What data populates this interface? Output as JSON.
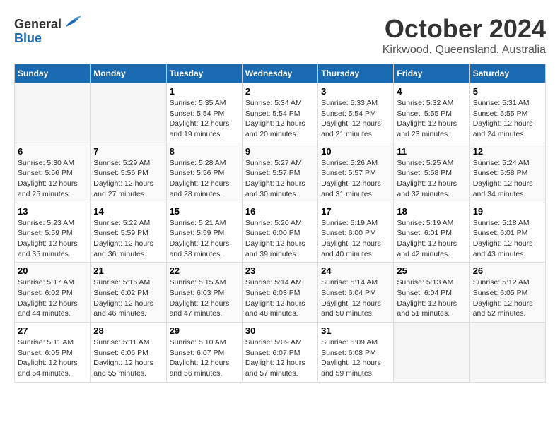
{
  "header": {
    "logo_general": "General",
    "logo_blue": "Blue",
    "month_title": "October 2024",
    "location": "Kirkwood, Queensland, Australia"
  },
  "days_of_week": [
    "Sunday",
    "Monday",
    "Tuesday",
    "Wednesday",
    "Thursday",
    "Friday",
    "Saturday"
  ],
  "weeks": [
    [
      {
        "day": "",
        "sunrise": "",
        "sunset": "",
        "daylight": ""
      },
      {
        "day": "",
        "sunrise": "",
        "sunset": "",
        "daylight": ""
      },
      {
        "day": "1",
        "sunrise": "Sunrise: 5:35 AM",
        "sunset": "Sunset: 5:54 PM",
        "daylight": "Daylight: 12 hours and 19 minutes."
      },
      {
        "day": "2",
        "sunrise": "Sunrise: 5:34 AM",
        "sunset": "Sunset: 5:54 PM",
        "daylight": "Daylight: 12 hours and 20 minutes."
      },
      {
        "day": "3",
        "sunrise": "Sunrise: 5:33 AM",
        "sunset": "Sunset: 5:54 PM",
        "daylight": "Daylight: 12 hours and 21 minutes."
      },
      {
        "day": "4",
        "sunrise": "Sunrise: 5:32 AM",
        "sunset": "Sunset: 5:55 PM",
        "daylight": "Daylight: 12 hours and 23 minutes."
      },
      {
        "day": "5",
        "sunrise": "Sunrise: 5:31 AM",
        "sunset": "Sunset: 5:55 PM",
        "daylight": "Daylight: 12 hours and 24 minutes."
      }
    ],
    [
      {
        "day": "6",
        "sunrise": "Sunrise: 5:30 AM",
        "sunset": "Sunset: 5:56 PM",
        "daylight": "Daylight: 12 hours and 25 minutes."
      },
      {
        "day": "7",
        "sunrise": "Sunrise: 5:29 AM",
        "sunset": "Sunset: 5:56 PM",
        "daylight": "Daylight: 12 hours and 27 minutes."
      },
      {
        "day": "8",
        "sunrise": "Sunrise: 5:28 AM",
        "sunset": "Sunset: 5:56 PM",
        "daylight": "Daylight: 12 hours and 28 minutes."
      },
      {
        "day": "9",
        "sunrise": "Sunrise: 5:27 AM",
        "sunset": "Sunset: 5:57 PM",
        "daylight": "Daylight: 12 hours and 30 minutes."
      },
      {
        "day": "10",
        "sunrise": "Sunrise: 5:26 AM",
        "sunset": "Sunset: 5:57 PM",
        "daylight": "Daylight: 12 hours and 31 minutes."
      },
      {
        "day": "11",
        "sunrise": "Sunrise: 5:25 AM",
        "sunset": "Sunset: 5:58 PM",
        "daylight": "Daylight: 12 hours and 32 minutes."
      },
      {
        "day": "12",
        "sunrise": "Sunrise: 5:24 AM",
        "sunset": "Sunset: 5:58 PM",
        "daylight": "Daylight: 12 hours and 34 minutes."
      }
    ],
    [
      {
        "day": "13",
        "sunrise": "Sunrise: 5:23 AM",
        "sunset": "Sunset: 5:59 PM",
        "daylight": "Daylight: 12 hours and 35 minutes."
      },
      {
        "day": "14",
        "sunrise": "Sunrise: 5:22 AM",
        "sunset": "Sunset: 5:59 PM",
        "daylight": "Daylight: 12 hours and 36 minutes."
      },
      {
        "day": "15",
        "sunrise": "Sunrise: 5:21 AM",
        "sunset": "Sunset: 5:59 PM",
        "daylight": "Daylight: 12 hours and 38 minutes."
      },
      {
        "day": "16",
        "sunrise": "Sunrise: 5:20 AM",
        "sunset": "Sunset: 6:00 PM",
        "daylight": "Daylight: 12 hours and 39 minutes."
      },
      {
        "day": "17",
        "sunrise": "Sunrise: 5:19 AM",
        "sunset": "Sunset: 6:00 PM",
        "daylight": "Daylight: 12 hours and 40 minutes."
      },
      {
        "day": "18",
        "sunrise": "Sunrise: 5:19 AM",
        "sunset": "Sunset: 6:01 PM",
        "daylight": "Daylight: 12 hours and 42 minutes."
      },
      {
        "day": "19",
        "sunrise": "Sunrise: 5:18 AM",
        "sunset": "Sunset: 6:01 PM",
        "daylight": "Daylight: 12 hours and 43 minutes."
      }
    ],
    [
      {
        "day": "20",
        "sunrise": "Sunrise: 5:17 AM",
        "sunset": "Sunset: 6:02 PM",
        "daylight": "Daylight: 12 hours and 44 minutes."
      },
      {
        "day": "21",
        "sunrise": "Sunrise: 5:16 AM",
        "sunset": "Sunset: 6:02 PM",
        "daylight": "Daylight: 12 hours and 46 minutes."
      },
      {
        "day": "22",
        "sunrise": "Sunrise: 5:15 AM",
        "sunset": "Sunset: 6:03 PM",
        "daylight": "Daylight: 12 hours and 47 minutes."
      },
      {
        "day": "23",
        "sunrise": "Sunrise: 5:14 AM",
        "sunset": "Sunset: 6:03 PM",
        "daylight": "Daylight: 12 hours and 48 minutes."
      },
      {
        "day": "24",
        "sunrise": "Sunrise: 5:14 AM",
        "sunset": "Sunset: 6:04 PM",
        "daylight": "Daylight: 12 hours and 50 minutes."
      },
      {
        "day": "25",
        "sunrise": "Sunrise: 5:13 AM",
        "sunset": "Sunset: 6:04 PM",
        "daylight": "Daylight: 12 hours and 51 minutes."
      },
      {
        "day": "26",
        "sunrise": "Sunrise: 5:12 AM",
        "sunset": "Sunset: 6:05 PM",
        "daylight": "Daylight: 12 hours and 52 minutes."
      }
    ],
    [
      {
        "day": "27",
        "sunrise": "Sunrise: 5:11 AM",
        "sunset": "Sunset: 6:05 PM",
        "daylight": "Daylight: 12 hours and 54 minutes."
      },
      {
        "day": "28",
        "sunrise": "Sunrise: 5:11 AM",
        "sunset": "Sunset: 6:06 PM",
        "daylight": "Daylight: 12 hours and 55 minutes."
      },
      {
        "day": "29",
        "sunrise": "Sunrise: 5:10 AM",
        "sunset": "Sunset: 6:07 PM",
        "daylight": "Daylight: 12 hours and 56 minutes."
      },
      {
        "day": "30",
        "sunrise": "Sunrise: 5:09 AM",
        "sunset": "Sunset: 6:07 PM",
        "daylight": "Daylight: 12 hours and 57 minutes."
      },
      {
        "day": "31",
        "sunrise": "Sunrise: 5:09 AM",
        "sunset": "Sunset: 6:08 PM",
        "daylight": "Daylight: 12 hours and 59 minutes."
      },
      {
        "day": "",
        "sunrise": "",
        "sunset": "",
        "daylight": ""
      },
      {
        "day": "",
        "sunrise": "",
        "sunset": "",
        "daylight": ""
      }
    ]
  ]
}
